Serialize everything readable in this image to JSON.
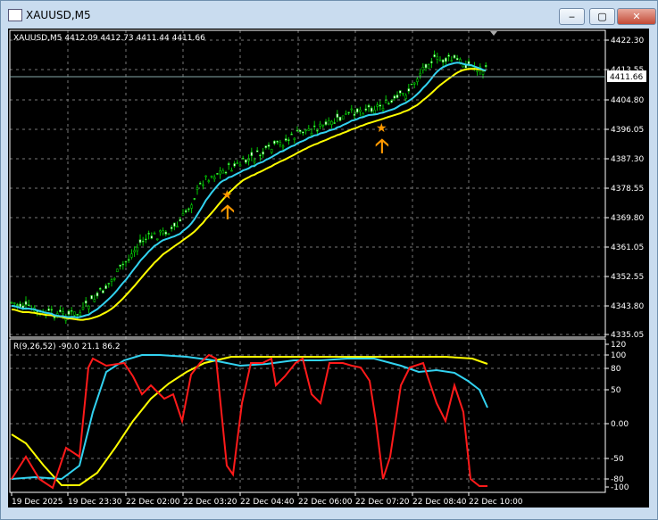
{
  "window": {
    "title": "XAUUSD,M5",
    "buttons": {
      "minimize": "‒",
      "maximize": "▢",
      "close": "✕"
    }
  },
  "main": {
    "header": "XAUUSD,M5  4412.09 4412.73 4411.44 4411.66",
    "current_price": "4411.66",
    "price_ticks": [
      "4422.30",
      "4413.55",
      "4404.80",
      "4396.05",
      "4387.30",
      "4378.55",
      "4369.80",
      "4361.05",
      "4352.55",
      "4343.80",
      "4335.05"
    ]
  },
  "indicator": {
    "header": "R(9,26,52) -90.0 21.1 86.2",
    "ticks": [
      "120",
      "100",
      "80",
      "50",
      "0.00",
      "-50",
      "-80",
      "-100"
    ]
  },
  "time_axis": [
    "19 Dec 2025",
    "19 Dec 23:30",
    "22 Dec 02:00",
    "22 Dec 03:20",
    "22 Dec 04:40",
    "22 Dec 06:00",
    "22 Dec 07:20",
    "22 Dec 08:40",
    "22 Dec 10:00"
  ],
  "colors": {
    "bull": "#00c800",
    "fast_ma": "#32d2f0",
    "slow_ma": "#ffff00",
    "rsi_fast": "#ff1a1a",
    "rsi_mid": "#32d2f0",
    "rsi_slow": "#ffff00",
    "arrow": "#ff9900"
  }
}
